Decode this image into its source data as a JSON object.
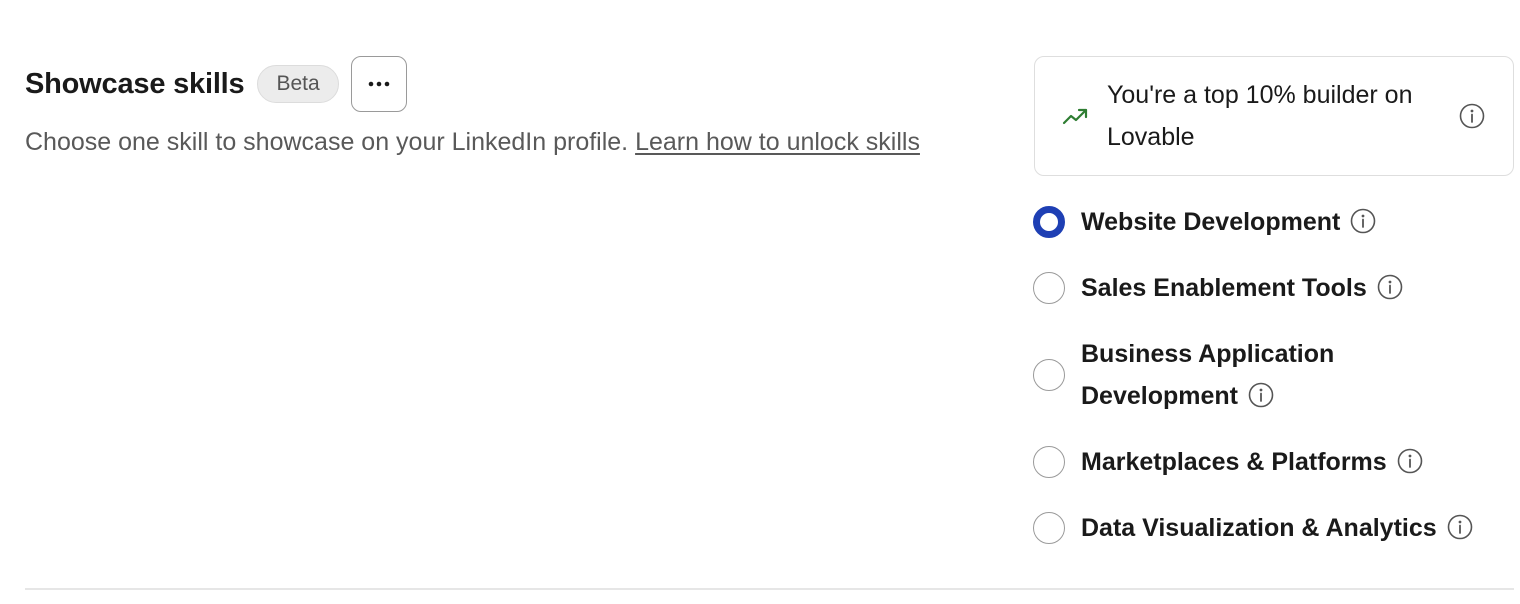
{
  "section": {
    "title": "Showcase skills",
    "badge": "Beta",
    "more_button_icon": "ellipsis-icon",
    "description": "Choose one skill to showcase on your LinkedIn profile.",
    "learn_link": "Learn how to unlock skills"
  },
  "status_card": {
    "icon": "trending-up-icon",
    "text": "You're a top 10% builder on Lovable",
    "info_icon": "info-icon"
  },
  "skills": {
    "selected": "Website Development",
    "options": [
      {
        "label": "Website Development",
        "checked": true
      },
      {
        "label": "Sales Enablement Tools",
        "checked": false
      },
      {
        "label": "Business Application Development",
        "checked": false
      },
      {
        "label": "Marketplaces & Platforms",
        "checked": false
      },
      {
        "label": "Data Visualization & Analytics",
        "checked": false
      }
    ]
  },
  "colors": {
    "radio_selected": "#1e3fb4",
    "trend_icon": "#2e7d32",
    "muted_text": "#595959"
  }
}
